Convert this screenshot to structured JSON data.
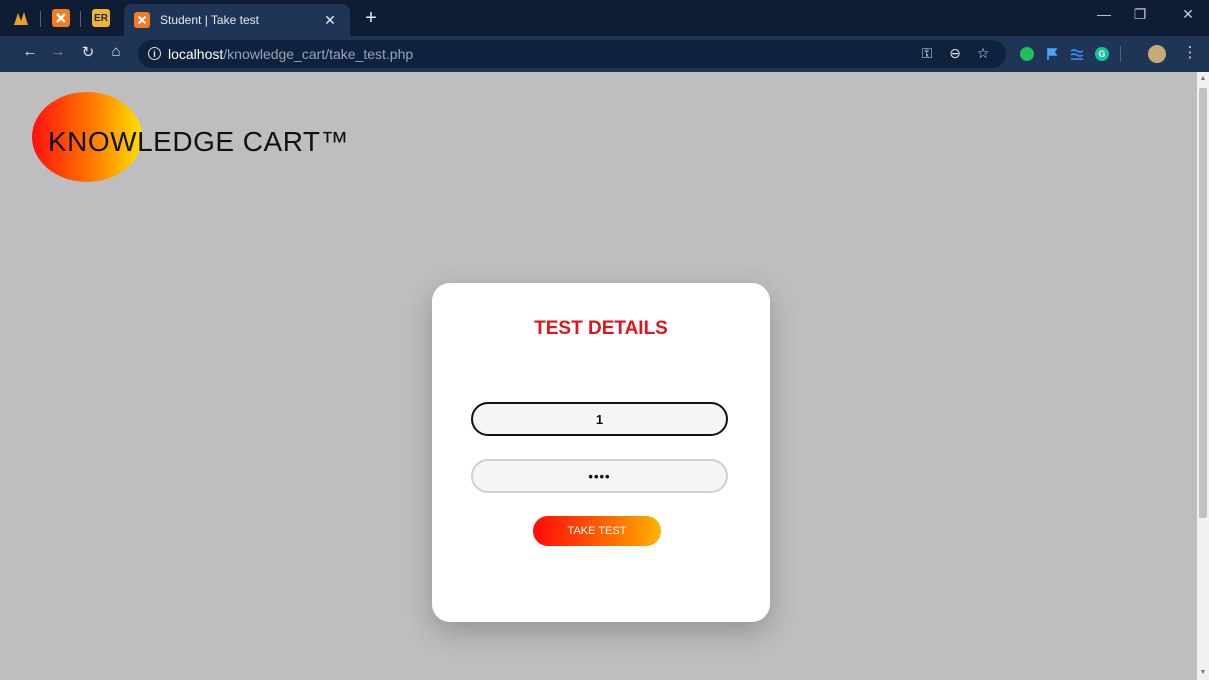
{
  "browser": {
    "pinned_tabs": [
      "",
      "ER"
    ],
    "active_tab": {
      "title": "Student | Take test"
    },
    "new_tab_label": "+",
    "address": {
      "host": "localhost",
      "path": "/knowledge_cart/take_test.php"
    }
  },
  "icons": {
    "back": "arrow-left-icon",
    "forward": "arrow-right-icon",
    "reload": "reload-icon",
    "home": "home-icon",
    "key": "key-icon",
    "zoom": "zoom-out-icon",
    "bookmark": "star-icon"
  },
  "colors": {
    "brand_red": "#e3131b",
    "gradient_start": "#ff0a0a",
    "gradient_end": "#ffb300",
    "page_bg": "#bebebe"
  },
  "logo": {
    "text": "KNOWLEDGE CART™"
  },
  "card": {
    "title": "TEST DETAILS",
    "test_code_value": "1",
    "password_value": "1234",
    "button_label": "TAKE TEST"
  }
}
